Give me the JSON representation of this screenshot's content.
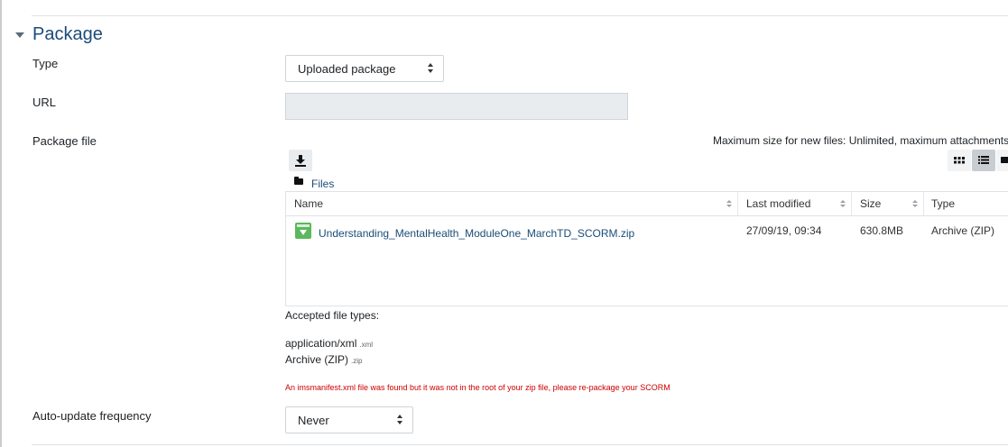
{
  "section": {
    "title": "Package"
  },
  "fields": {
    "type": {
      "label": "Type",
      "value": "Uploaded package"
    },
    "url": {
      "label": "URL",
      "value": ""
    },
    "package_file": {
      "label": "Package file"
    },
    "auto_update": {
      "label": "Auto-update frequency",
      "value": "Never"
    }
  },
  "filepicker": {
    "max_size_text": "Maximum size for new files: Unlimited, maximum attachments",
    "breadcrumb": "Files",
    "columns": [
      "Name",
      "Last modified",
      "Size",
      "Type"
    ],
    "files": [
      {
        "name": "Understanding_MentalHealth_ModuleOne_MarchTD_SCORM.zip",
        "modified": "27/09/19, 09:34",
        "size": "630.8MB",
        "type": "Archive (ZIP)"
      }
    ]
  },
  "accepted": {
    "title": "Accepted file types:",
    "types": [
      {
        "name": "application/xml",
        "ext": ".xml"
      },
      {
        "name": "Archive (ZIP)",
        "ext": ".zip"
      }
    ]
  },
  "error_message": "An imsmanifest.xml file was found but it was not in the root of your zip file, please re-package your SCORM",
  "colors": {
    "link": "#1a4c78",
    "error": "#cc0000",
    "zip_icon": "#5cb85c"
  },
  "icons": [
    "chevron-down-icon",
    "download-icon",
    "grid-view-icon",
    "list-view-icon",
    "tree-view-icon",
    "folder-icon",
    "zip-file-icon"
  ]
}
